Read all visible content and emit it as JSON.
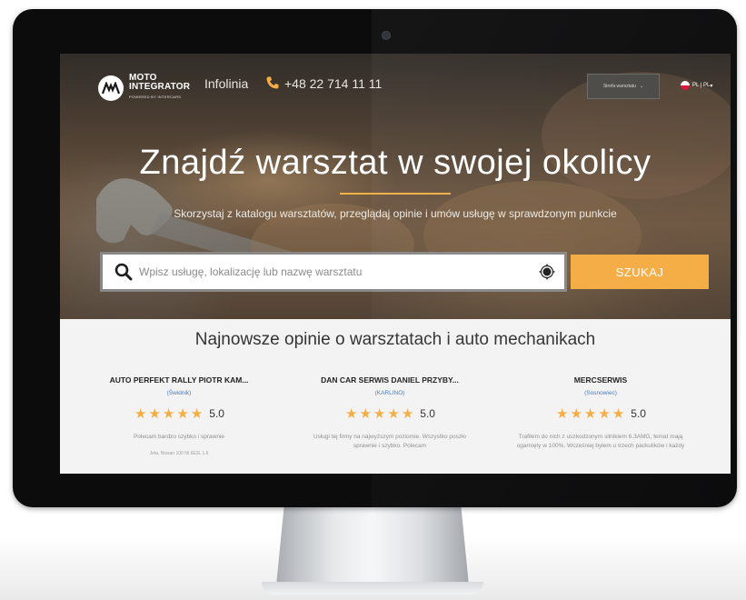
{
  "header": {
    "logo_line1": "MOTO",
    "logo_line2": "INTEGRATOR",
    "logo_line3": "POWERED BY INTERCARS",
    "hotline_label": "Infolinia",
    "phone": "+48 22 714 11 11",
    "zone_button": "Strefa warsztatu",
    "language": "PL | PL"
  },
  "hero": {
    "title": "Znajdź warsztat w swojej okolicy",
    "subtitle": "Skorzystaj z katalogu warsztatów, przeglądaj opinie i umów usługę w sprawdzonym punkcie"
  },
  "search": {
    "placeholder": "Wpisz usługę, lokalizację lub nazwę warsztatu",
    "button": "SZUKAJ"
  },
  "reviews": {
    "title": "Najnowsze opinie o warsztatach i auto mechanikach",
    "cards": [
      {
        "name": "AUTO PERFEKT RALLY PIOTR KAM...",
        "city": "(Świdnik)",
        "rating": "5.0",
        "stars": 5,
        "text": "Polecam bardzo szybko i sprawnie",
        "note": "Jeta, Nissan 100 NI 6E3L 1.6"
      },
      {
        "name": "DAN CAR SERWIS DANIEL PRZYBY...",
        "city": "(KARLINO)",
        "rating": "5.0",
        "stars": 5,
        "text": "Usługi tej firmy na najwyższym poziomie. Wszystko poszło sprawnie i szybko. Polecam",
        "note": ""
      },
      {
        "name": "MERCSERWIS",
        "city": "(Sosnowiec)",
        "rating": "5.0",
        "stars": 5,
        "text": "Trafiłem do nich z uszkodzonym silnikiem 6.3AMG, temat mają ogarnięty w 100%. Wcześniej byłem u trzech packulików i każdy",
        "note": ""
      }
    ]
  }
}
